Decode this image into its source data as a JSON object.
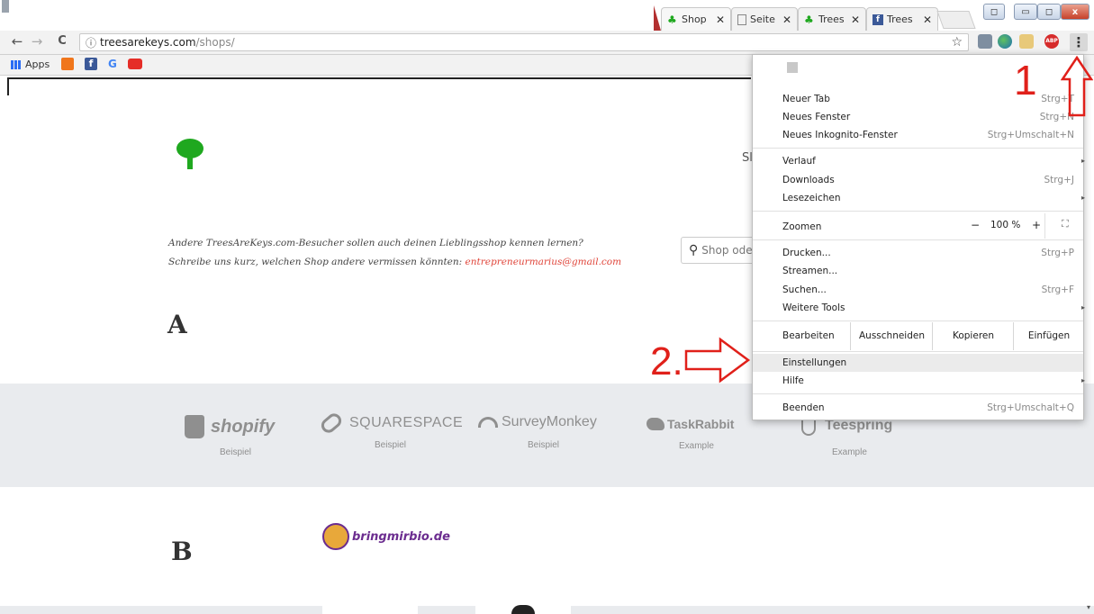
{
  "tabs": [
    {
      "title": "Shop",
      "close": "✕"
    },
    {
      "title": "Seite",
      "close": "✕"
    },
    {
      "title": "Trees",
      "close": "✕"
    },
    {
      "title": "Trees",
      "close": "✕"
    }
  ],
  "window_controls": {
    "user": "◻",
    "minimize": "▭",
    "maximize": "◻",
    "close": "x"
  },
  "toolbar": {
    "back": "←",
    "forward": "→",
    "reload": "C",
    "info": "ⓘ",
    "url_domain": "treesarekeys.com",
    "url_path": "/shops/",
    "star": "☆",
    "abp": "ABP",
    "menu": "⋮"
  },
  "bookmarks": {
    "apps": "Apps",
    "g": "G"
  },
  "page": {
    "header_letter_partial": "Sl",
    "intro_line1": "Andere TreesAreKeys.com-Besucher sollen auch deinen Lieblingsshop kennen lernen?",
    "intro_line2_prefix": "Schreibe uns kurz, welchen Shop andere vermissen könnten: ",
    "intro_email": "entrepreneurmarius@gmail.com",
    "search_placeholder": "Shop ode",
    "section_a": "A",
    "section_b": "B",
    "shops_a": [
      {
        "name": "shopify",
        "caption": "Beispiel"
      },
      {
        "name": "SQUARESPACE",
        "caption": "Beispiel"
      },
      {
        "name": "SurveyMonkey",
        "caption": "Beispiel"
      },
      {
        "name": "TaskRabbit",
        "caption": "Example"
      },
      {
        "name": "Teespring",
        "caption": "Example"
      }
    ],
    "shop_b": "bringmirbio.de"
  },
  "menu": {
    "items": [
      {
        "label": "Neuer Tab",
        "shortcut": "Strg+T"
      },
      {
        "label": "Neues Fenster",
        "shortcut": "Strg+N"
      },
      {
        "label": "Neues Inkognito-Fenster",
        "shortcut": "Strg+Umschalt+N"
      },
      {
        "label": "Verlauf",
        "shortcut": "▸"
      },
      {
        "label": "Downloads",
        "shortcut": "Strg+J"
      },
      {
        "label": "Lesezeichen",
        "shortcut": "▸"
      },
      {
        "label": "Zoomen",
        "shortcut": ""
      },
      {
        "label": "Drucken...",
        "shortcut": "Strg+P"
      },
      {
        "label": "Streamen...",
        "shortcut": ""
      },
      {
        "label": "Suchen...",
        "shortcut": "Strg+F"
      },
      {
        "label": "Weitere Tools",
        "shortcut": "▸"
      },
      {
        "label": "Einstellungen",
        "shortcut": ""
      },
      {
        "label": "Hilfe",
        "shortcut": "▸"
      },
      {
        "label": "Beenden",
        "shortcut": "Strg+Umschalt+Q"
      }
    ],
    "zoom": {
      "minus": "−",
      "value": "100 %",
      "plus": "+",
      "fullscreen": "⛶"
    },
    "edit": {
      "label": "Bearbeiten",
      "cut": "Ausschneiden",
      "copy": "Kopieren",
      "paste": "Einfügen"
    }
  },
  "annotations": {
    "step1": "1",
    "step2": "2."
  },
  "colors": {
    "brand_green": "#1fa81f",
    "annotation_red": "#e0201a",
    "email_red": "#e0453a",
    "bringmirbio_purple": "#6b2c8f"
  }
}
